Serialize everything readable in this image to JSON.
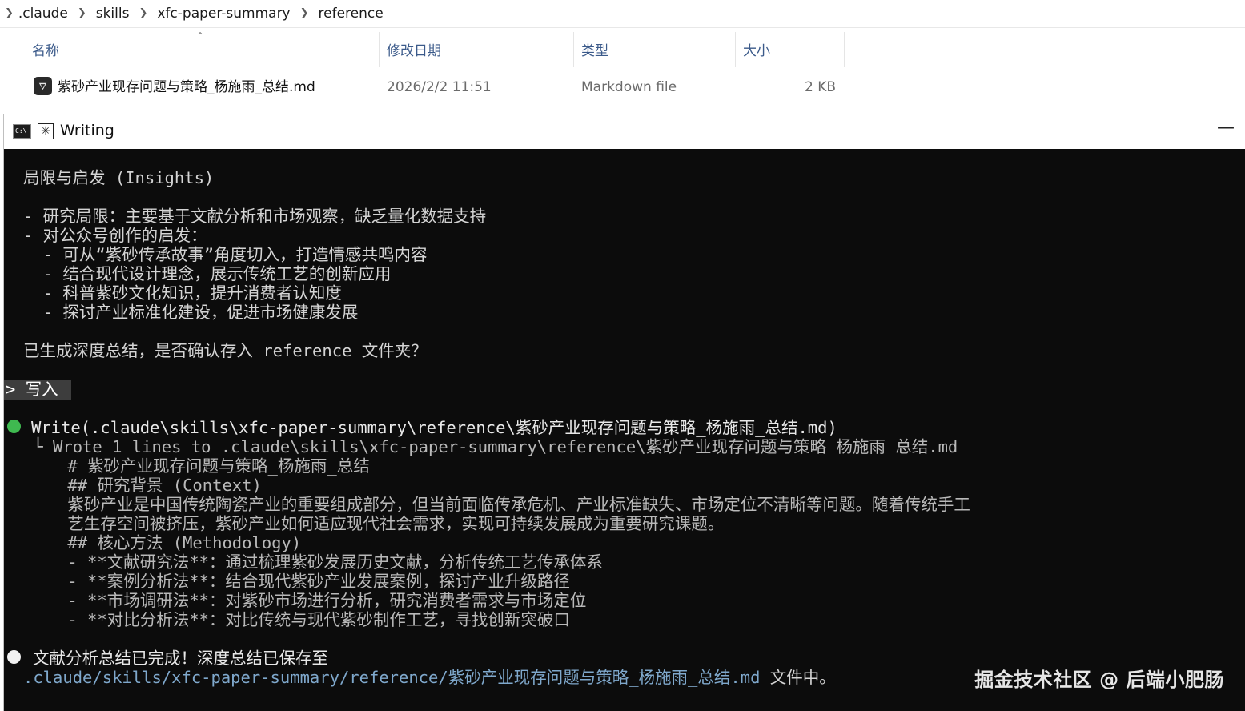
{
  "explorer": {
    "breadcrumb": [
      ".claude",
      "skills",
      "xfc-paper-summary",
      "reference"
    ],
    "columns": {
      "name": "名称",
      "modified": "修改日期",
      "type": "类型",
      "size": "大小"
    },
    "sort_icon": "chevron-up-icon",
    "file": {
      "name": "紫砂产业现存问题与策略_杨施雨_总结.md",
      "modified": "2026/2/2 11:51",
      "type": "Markdown file",
      "size": "2 KB",
      "icon": "markdown-file-icon"
    }
  },
  "terminal": {
    "title": "Writing",
    "icons": [
      "cmd-icon",
      "sparkle-icon",
      "minimize-icon"
    ],
    "lines": {
      "insights_heading": "局限与启发 (Insights)",
      "limit": "- 研究局限：主要基于文献分析和市场观察，缺乏量化数据支持",
      "inspire": "- 对公众号创作的启发：",
      "inspire_1": "  - 可从“紫砂传承故事”角度切入，打造情感共鸣内容",
      "inspire_2": "  - 结合现代设计理念，展示传统工艺的创新应用",
      "inspire_3": "  - 科普紫砂文化知识，提升消费者认知度",
      "inspire_4": "  - 探讨产业标准化建设，促进市场健康发展",
      "confirm": "已生成深度总结，是否确认存入 reference 文件夹？",
      "choice": "> 写入",
      "write_call": "Write(.claude\\skills\\xfc-paper-summary\\reference\\紫砂产业现存问题与策略_杨施雨_总结.md)",
      "wrote": " └ Wrote 1 lines to .claude\\skills\\xfc-paper-summary\\reference\\紫砂产业现存问题与策略_杨施雨_总结.md",
      "md_title": "    # 紫砂产业现存问题与策略_杨施雨_总结",
      "md_h_context": "    ## 研究背景 (Context)",
      "md_context_1": "    紫砂产业是中国传统陶瓷产业的重要组成部分，但当前面临传承危机、产业标准缺失、市场定位不清晰等问题。随着传统手工",
      "md_context_2": "    艺生存空间被挤压，紫砂产业如何适应现代社会需求，实现可持续发展成为重要研究课题。",
      "md_h_method": "    ## 核心方法 (Methodology)",
      "md_method_1": "    - **文献研究法**：通过梳理紫砂发展历史文献，分析传统工艺传承体系",
      "md_method_2": "    - **案例分析法**：结合现代紫砂产业发展案例，探讨产业升级路径",
      "md_method_3": "    - **市场调研法**：对紫砂市场进行分析，研究消费者需求与市场定位",
      "md_method_4": "    - **对比分析法**：对比传统与现代紫砂制作工艺，寻找创新突破口",
      "done": "文献分析总结已完成！深度总结已保存至",
      "done_path": ".claude/skills/xfc-paper-summary/reference/紫砂产业现存问题与策略_杨施雨_总结.md",
      "done_suffix": " 文件中。"
    },
    "status_colors": {
      "success_dot": "#3fb950",
      "info_dot": "#f2f2f2"
    }
  },
  "watermark": "掘金技术社区 @ 后端小肥肠"
}
